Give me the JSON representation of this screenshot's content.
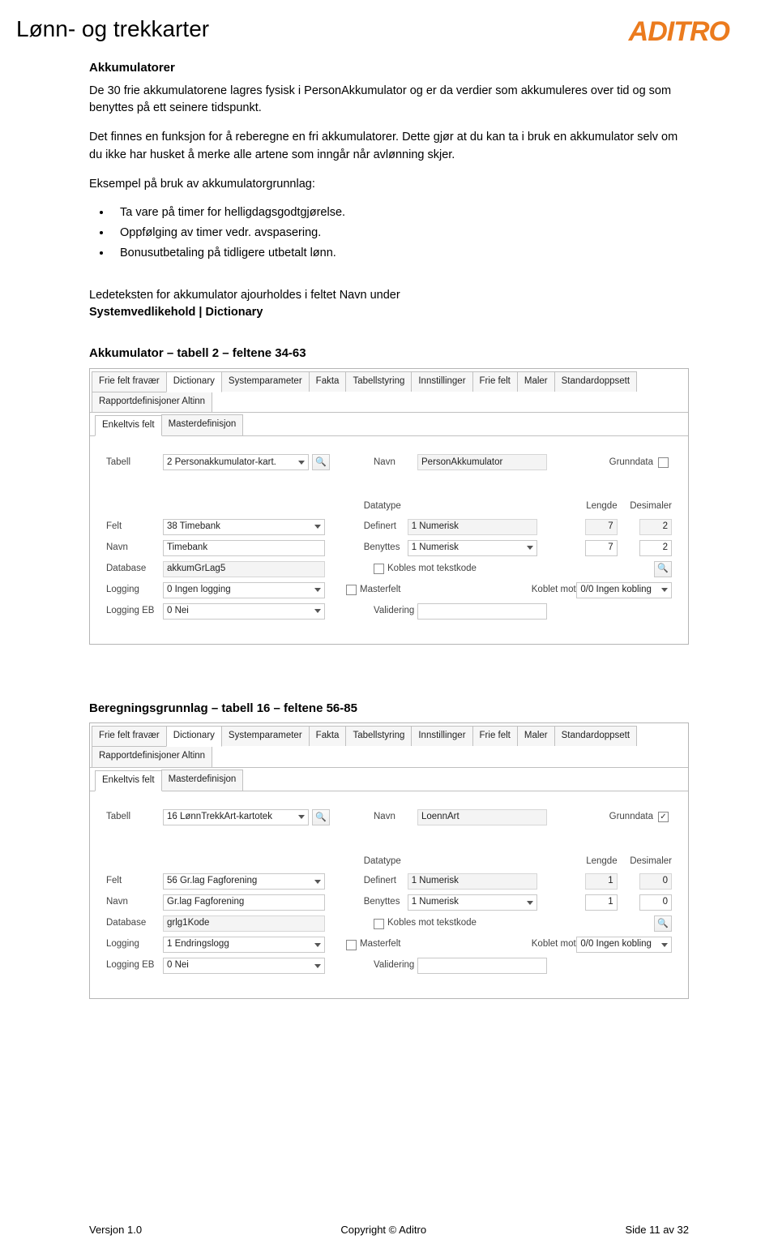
{
  "header": {
    "title": "Lønn- og trekkarter",
    "logo": "ADITRO"
  },
  "section": {
    "heading": "Akkumulatorer",
    "p1": "De 30 frie akkumulatorene lagres fysisk i PersonAkkumulator og er da verdier som akkumuleres over tid og som benyttes på ett seinere tidspunkt.",
    "p2": "Det finnes en funksjon for å reberegne en fri akkumulatorer. Dette gjør at du kan ta i bruk en akkumulator selv om du ikke har husket å merke alle artene som inngår når avlønning skjer.",
    "p3": "Eksempel på bruk av akkumulatorgrunnlag:",
    "bullets": [
      "Ta vare på timer for helligdagsgodtgjørelse.",
      "Oppfølging av timer vedr. avspasering.",
      "Bonusutbetaling på tidligere utbetalt lønn."
    ],
    "p4a": "Ledeteksten for akkumulator ajourholdes i feltet Navn under",
    "p4b": "Systemvedlikehold | Dictionary",
    "lab1": "Akkumulator – tabell 2 – feltene 34-63",
    "lab2": "Beregningsgrunnlag – tabell 16 – feltene 56-85"
  },
  "tabs_main": [
    "Frie felt fravær",
    "Dictionary",
    "Systemparameter",
    "Fakta",
    "Tabellstyring",
    "Innstillinger",
    "Frie felt",
    "Maler",
    "Standardoppsett",
    "Rapportdefinisjoner Altinn"
  ],
  "tabs_sub": [
    "Enkeltvis felt",
    "Masterdefinisjon"
  ],
  "labels": {
    "tabell": "Tabell",
    "navn": "Navn",
    "grunndata": "Grunndata",
    "datatype": "Datatype",
    "lengde": "Lengde",
    "desimaler": "Desimaler",
    "felt": "Felt",
    "definert": "Definert",
    "benyttes": "Benyttes",
    "database": "Database",
    "kobles": "Kobles mot tekstkode",
    "logging": "Logging",
    "masterfelt": "Masterfelt",
    "koblet": "Koblet mot",
    "loggingeb": "Logging EB",
    "validering": "Validering"
  },
  "panel1": {
    "tabell": "2 Personakkumulator-kart.",
    "navn_top": "PersonAkkumulator",
    "grunndata": false,
    "felt": "38 Timebank",
    "definert": "1 Numerisk",
    "lengde1": "7",
    "des1": "2",
    "navn": "Timebank",
    "benyttes": "1 Numerisk",
    "lengde2": "7",
    "des2": "2",
    "database": "akkumGrLag5",
    "logging": "0 Ingen logging",
    "koblet": "0/0 Ingen kobling",
    "loggingeb": "0 Nei"
  },
  "panel2": {
    "tabell": "16 LønnTrekkArt-kartotek",
    "navn_top": "LoennArt",
    "grunndata": true,
    "felt": "56 Gr.lag Fagforening",
    "definert": "1 Numerisk",
    "lengde1": "1",
    "des1": "0",
    "navn": "Gr.lag Fagforening",
    "benyttes": "1 Numerisk",
    "lengde2": "1",
    "des2": "0",
    "database": "grlg1Kode",
    "logging": "1 Endringslogg",
    "koblet": "0/0 Ingen kobling",
    "loggingeb": "0 Nei"
  },
  "footer": {
    "left": "Versjon 1.0",
    "center": "Copyright © Aditro",
    "right": "Side 11 av 32"
  }
}
